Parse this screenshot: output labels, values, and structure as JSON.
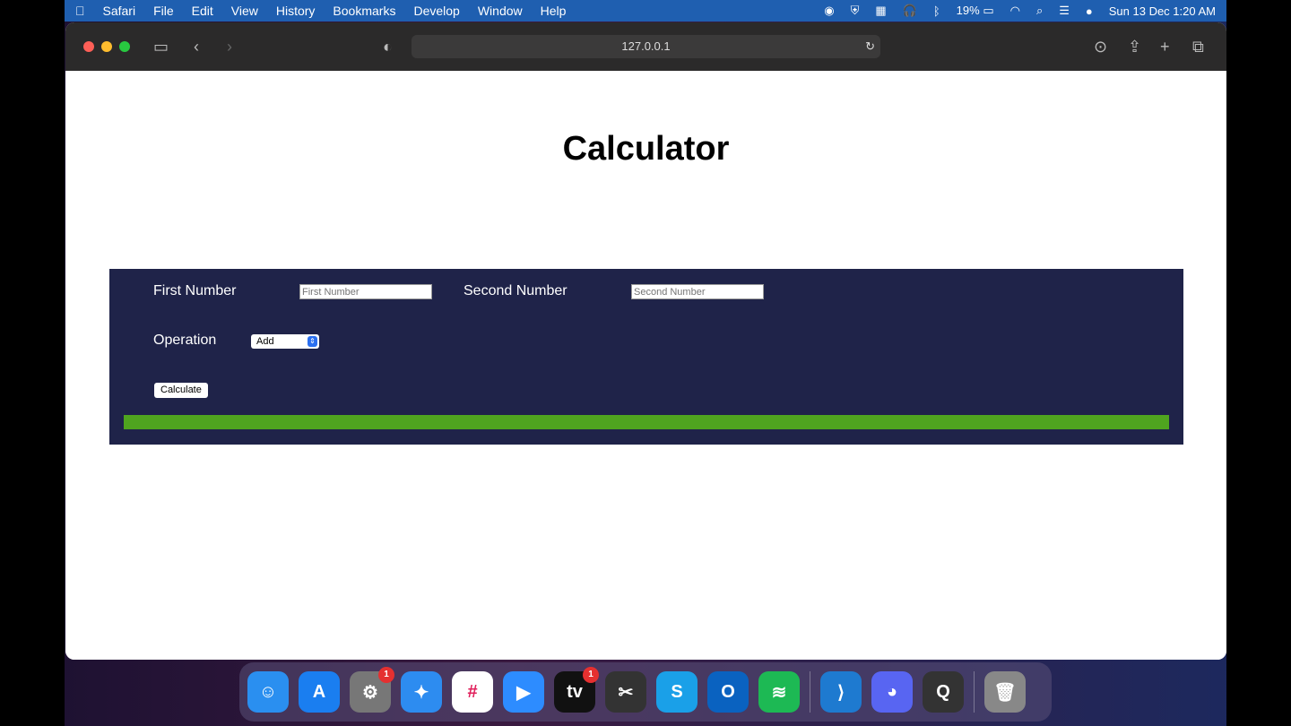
{
  "menubar": {
    "app": "Safari",
    "items": [
      "File",
      "Edit",
      "View",
      "History",
      "Bookmarks",
      "Develop",
      "Window",
      "Help"
    ],
    "battery": "19%",
    "datetime": "Sun 13 Dec  1:20 AM"
  },
  "browser": {
    "url": "127.0.0.1"
  },
  "page": {
    "title": "Calculator",
    "first_label": "First Number",
    "first_placeholder": "First Number",
    "second_label": "Second Number",
    "second_placeholder": "Second Number",
    "operation_label": "Operation",
    "operation_value": "Add",
    "calculate_label": "Calculate",
    "result_bar_color": "#4fa41f"
  },
  "dock": [
    {
      "name": "finder",
      "c": "#2a8ff0",
      "g": "☺"
    },
    {
      "name": "app-store",
      "c": "#1a7ef0",
      "g": "A"
    },
    {
      "name": "system-preferences",
      "c": "#777",
      "g": "⚙",
      "badge": "1"
    },
    {
      "name": "safari",
      "c": "#2d8cf0",
      "g": "✦"
    },
    {
      "name": "slack",
      "c": "#fff",
      "g": "#"
    },
    {
      "name": "zoom",
      "c": "#2d8cff",
      "g": "▶"
    },
    {
      "name": "apple-tv",
      "c": "#111",
      "g": "tv",
      "badge": "1"
    },
    {
      "name": "final-cut",
      "c": "#333",
      "g": "✂"
    },
    {
      "name": "skype",
      "c": "#1aa0e8",
      "g": "S"
    },
    {
      "name": "outlook",
      "c": "#0a62c0",
      "g": "O"
    },
    {
      "name": "spotify",
      "c": "#1db954",
      "g": "≋"
    },
    {
      "sep": true
    },
    {
      "name": "vscode",
      "c": "#1e7ad0",
      "g": "⟩"
    },
    {
      "name": "discord",
      "c": "#5865f2",
      "g": "◕"
    },
    {
      "name": "quicktime",
      "c": "#333",
      "g": "Q"
    },
    {
      "sep": true
    },
    {
      "name": "trash",
      "c": "#888",
      "g": "🗑"
    }
  ]
}
